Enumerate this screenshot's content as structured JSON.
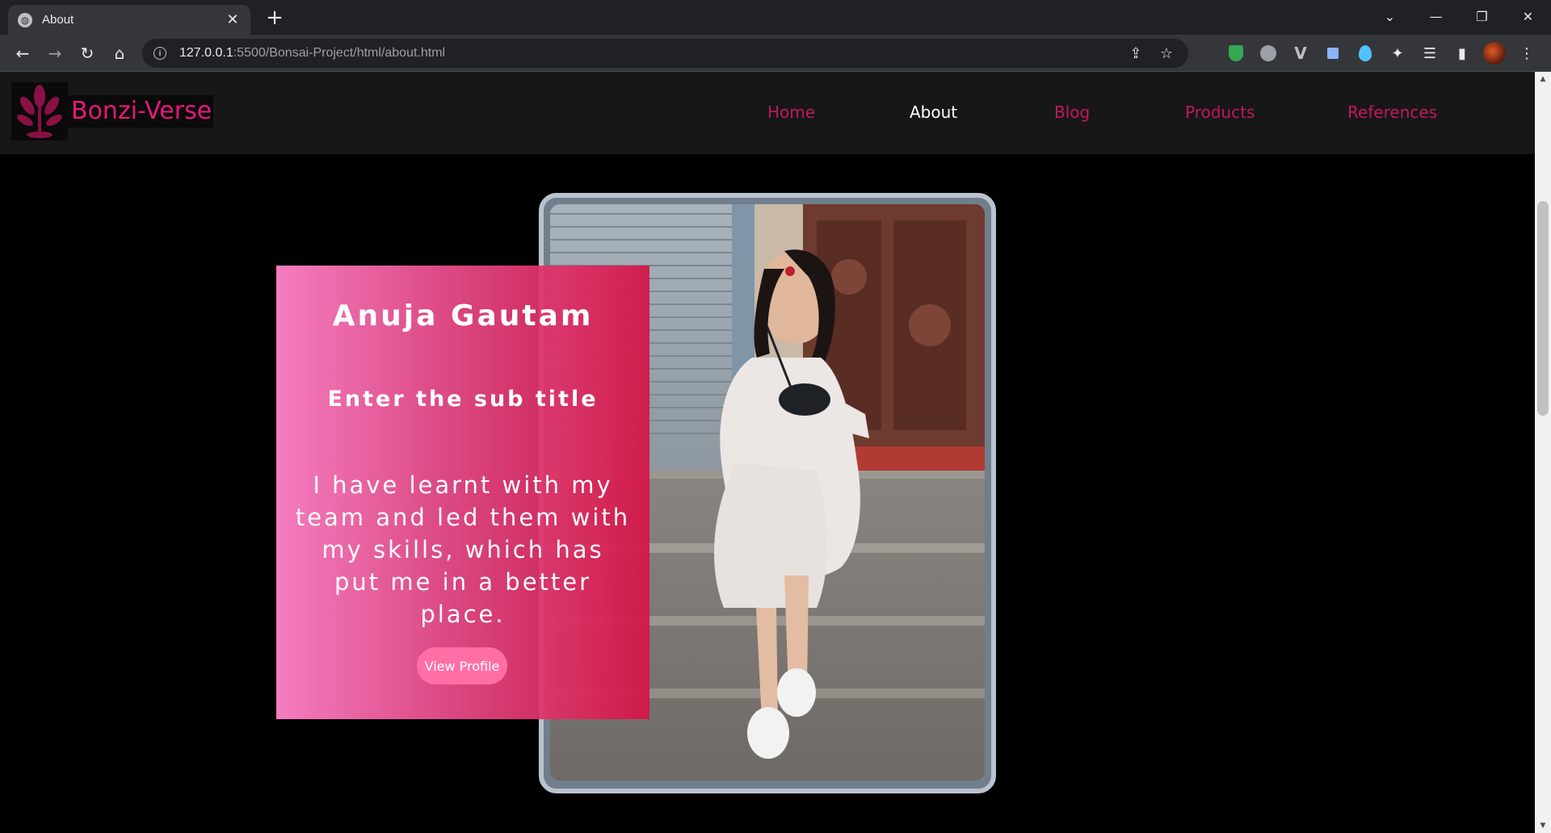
{
  "browser": {
    "tab_title": "About",
    "url_host": "127.0.0.1",
    "url_path": ":5500/Bonsai-Project/html/about.html"
  },
  "site": {
    "brand": "Bonzi-Verse",
    "nav": [
      {
        "label": "Home",
        "active": false
      },
      {
        "label": "About",
        "active": true
      },
      {
        "label": "Blog",
        "active": false
      },
      {
        "label": "Products",
        "active": false
      },
      {
        "label": "References",
        "active": false
      }
    ]
  },
  "profile": {
    "name": "Anuja Gautam",
    "subtitle": "Enter the sub title",
    "bio": "I have learnt with my team and led them with my skills, which has put me in a better place.",
    "button_label": "View Profile"
  },
  "colors": {
    "brand_pink": "#e6197a",
    "nav_link": "#c2185b",
    "card_gradient_start": "#ff82c8",
    "card_gradient_end": "#d41446",
    "button": "#ff6fa6",
    "page_bg": "#000000",
    "header_bg": "#171717"
  },
  "icons": {
    "tab_favicon": "globe-icon",
    "tab_close": "close-icon",
    "new_tab": "plus-icon",
    "back": "arrow-left-icon",
    "forward": "arrow-right-icon",
    "reload": "reload-icon",
    "home": "home-icon",
    "site_info": "info-icon",
    "share": "share-icon",
    "bookmark": "star-icon",
    "logo": "leaf-icon"
  }
}
